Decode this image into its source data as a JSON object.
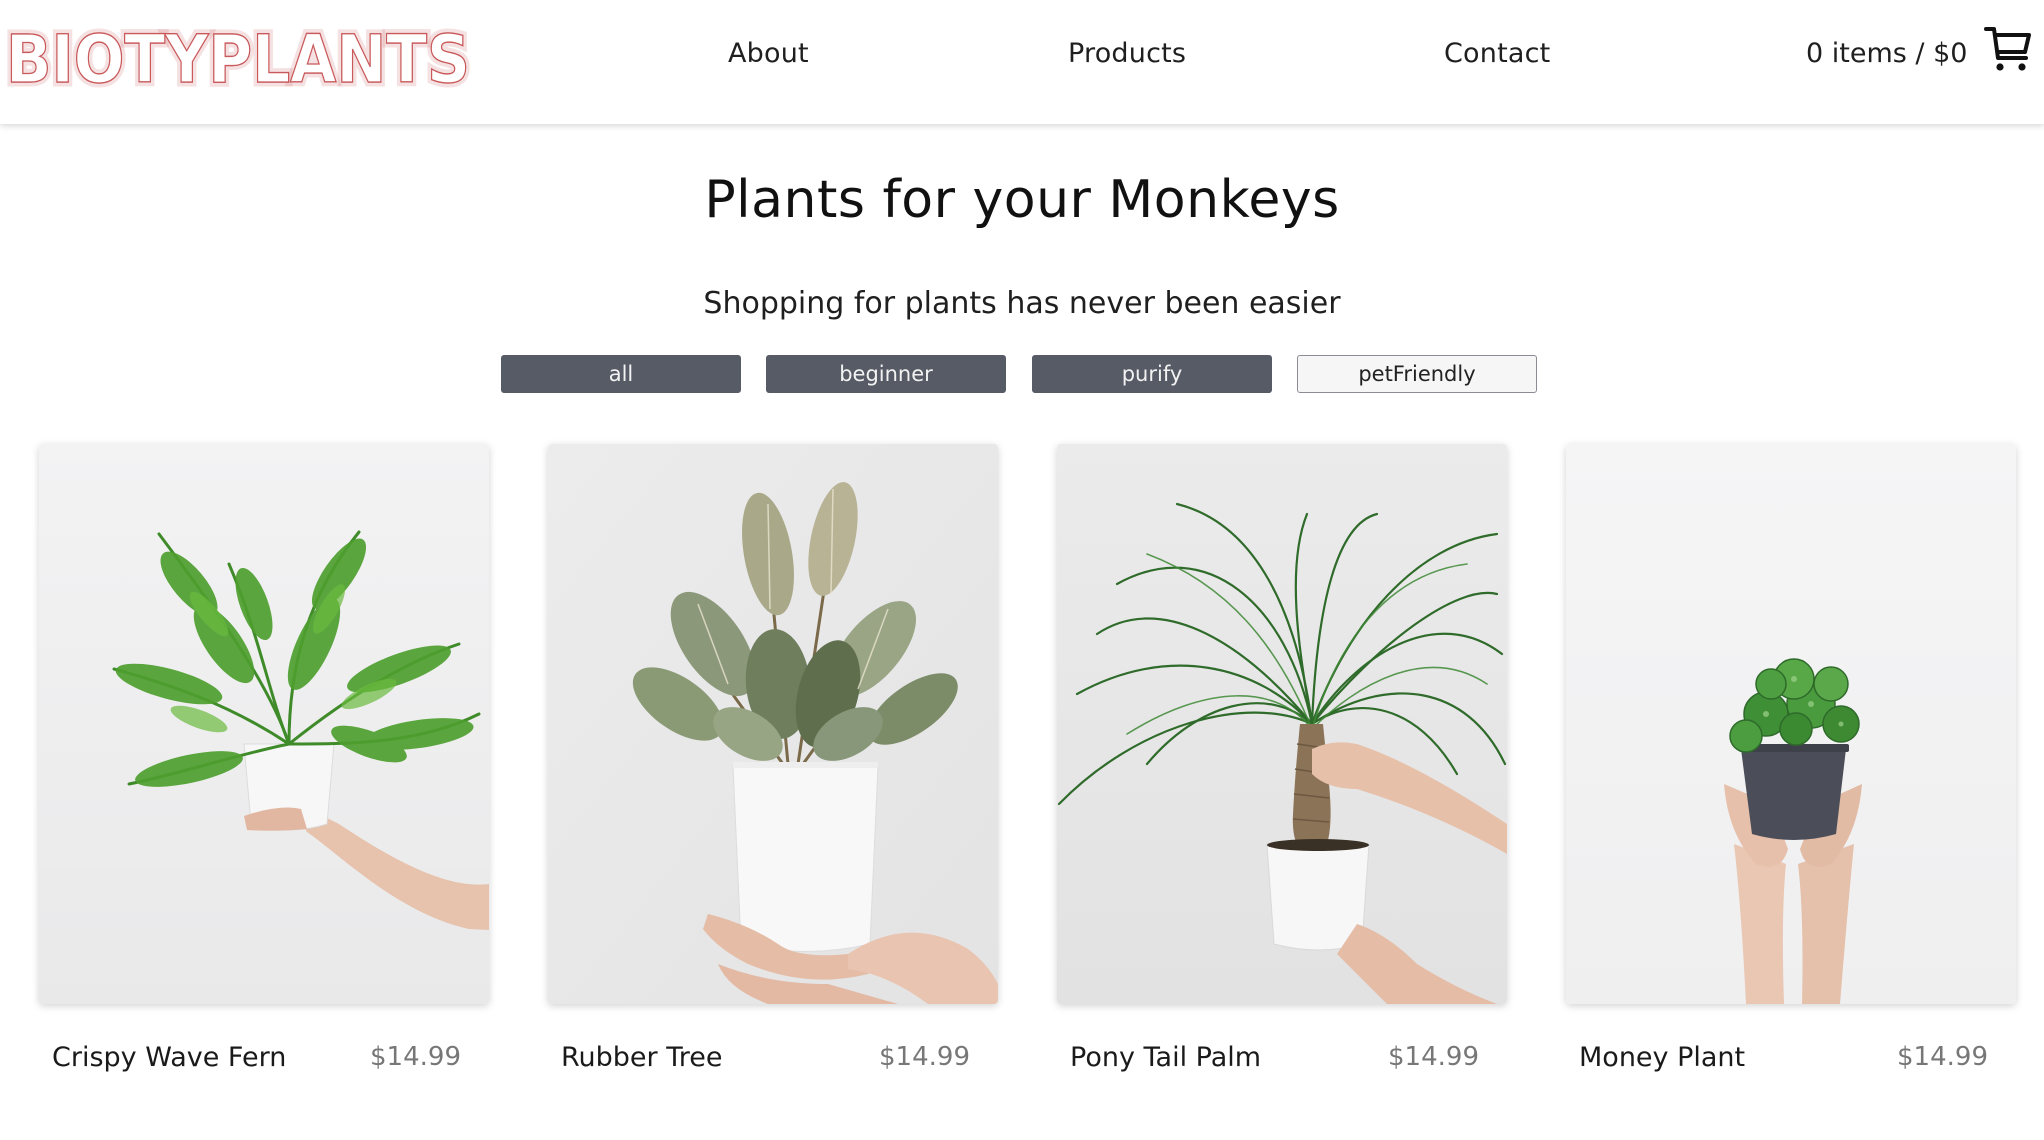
{
  "header": {
    "logo_text": "BIOTYPLANTS",
    "nav": {
      "about": "About",
      "products": "Products",
      "contact": "Contact"
    },
    "cart_summary": "0 items / $0",
    "logo_color": "#c9595b"
  },
  "hero": {
    "title": "Plants for your Monkeys",
    "subtitle": "Shopping for plants has never been easier"
  },
  "filters": [
    {
      "label": "all",
      "active": false
    },
    {
      "label": "beginner",
      "active": false
    },
    {
      "label": "purify",
      "active": false
    },
    {
      "label": "petFriendly",
      "active": true
    }
  ],
  "products": [
    {
      "name": "Crispy Wave Fern",
      "price": "$14.99"
    },
    {
      "name": "Rubber Tree",
      "price": "$14.99"
    },
    {
      "name": "Pony Tail Palm",
      "price": "$14.99"
    },
    {
      "name": "Money Plant",
      "price": "$14.99"
    }
  ],
  "colors": {
    "filter_dark": "#565b66",
    "filter_light": "#f6f6f6",
    "price_gray": "#777777"
  }
}
